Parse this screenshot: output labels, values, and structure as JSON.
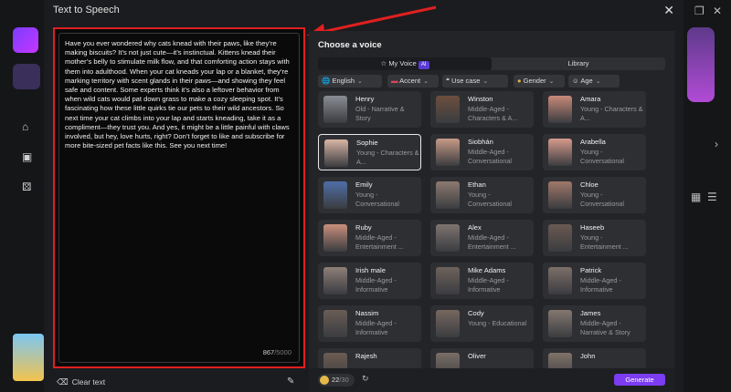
{
  "dialog": {
    "title": "Text to Speech"
  },
  "editor": {
    "text": "Have you ever wondered why cats knead with their paws, like they’re making biscuits? It’s not just cute—it’s instinctual. Kittens knead their mother’s belly to stimulate milk flow, and that comforting action stays with them into adulthood. When your cat kneads your lap or a blanket, they’re marking territory with scent glands in their paws—and showing they feel safe and content. Some experts think it’s also a leftover behavior from when wild cats would pat down grass to make a cozy sleeping spot. It’s fascinating how these little quirks tie our pets to their wild ancestors. So next time your cat climbs into your lap and starts kneading, take it as a compliment—they trust you. And yes, it might be a little painful with claws involved, but hey, love hurts, right? Don’t forget to like and subscribe for more bite-sized pet facts like this. See you next time!",
    "char_count": "867",
    "char_max": "/5000",
    "clear_label": "Clear text"
  },
  "voices_panel": {
    "title": "Choose a voice",
    "tabs": {
      "my_voice": "My Voice",
      "ai_badge": "AI",
      "library": "Library"
    },
    "filters": [
      "English",
      "Accent",
      "Use case",
      "Gender",
      "Age"
    ],
    "voices": [
      {
        "name": "Henry",
        "desc": "Old - Narrative & Story",
        "color": "#8a8c94"
      },
      {
        "name": "Winston",
        "desc": "Middle-Aged - Characters & A...",
        "color": "#6b4f3e"
      },
      {
        "name": "Amara",
        "desc": "Young - Characters & A...",
        "color": "#c88a78"
      },
      {
        "name": "Sophie",
        "desc": "Young - Characters & A...",
        "color": "#d8b5a4"
      },
      {
        "name": "Siobhán",
        "desc": "Middle-Aged - Conversational",
        "color": "#c79a86"
      },
      {
        "name": "Arabella",
        "desc": "Young - Conversational",
        "color": "#d69a8c"
      },
      {
        "name": "Emily",
        "desc": "Young - Conversational",
        "color": "#4f6fa8"
      },
      {
        "name": "Ethan",
        "desc": "Young - Conversational",
        "color": "#8c7a70"
      },
      {
        "name": "Chloe",
        "desc": "Young - Conversational",
        "color": "#a0786a"
      },
      {
        "name": "Ruby",
        "desc": "Middle-Aged - Entertainment ...",
        "color": "#c98f7a"
      },
      {
        "name": "Alex",
        "desc": "Middle-Aged - Entertainment ...",
        "color": "#7d7470"
      },
      {
        "name": "Haseeb",
        "desc": "Young - Entertainment ...",
        "color": "#6a5a52"
      },
      {
        "name": "Irish male",
        "desc": "Middle-Aged - Informative",
        "color": "#8d7f78"
      },
      {
        "name": "Mike Adams",
        "desc": "Middle-Aged - Informative",
        "color": "#6e625c"
      },
      {
        "name": "Patrick",
        "desc": "Middle-Aged - Informative",
        "color": "#7c6f68"
      },
      {
        "name": "Nassim",
        "desc": "Middle-Aged - Informative",
        "color": "#6a5d56"
      },
      {
        "name": "Cody",
        "desc": "Young - Educational",
        "color": "#76685f"
      },
      {
        "name": "James",
        "desc": "Middle-Aged - Narrative & Story",
        "color": "#847870"
      },
      {
        "name": "Rajesh",
        "desc": "",
        "color": "#6d5d52"
      },
      {
        "name": "Oliver",
        "desc": "",
        "color": "#7a6e66"
      },
      {
        "name": "John",
        "desc": "",
        "color": "#807369"
      }
    ],
    "selected_voice": "Sophie"
  },
  "footer": {
    "credits_used": "22",
    "credits_max": "/30",
    "generate_label": "Generate"
  },
  "colors": {
    "accent": "#7b3cf2",
    "highlight_border": "#e02020"
  }
}
